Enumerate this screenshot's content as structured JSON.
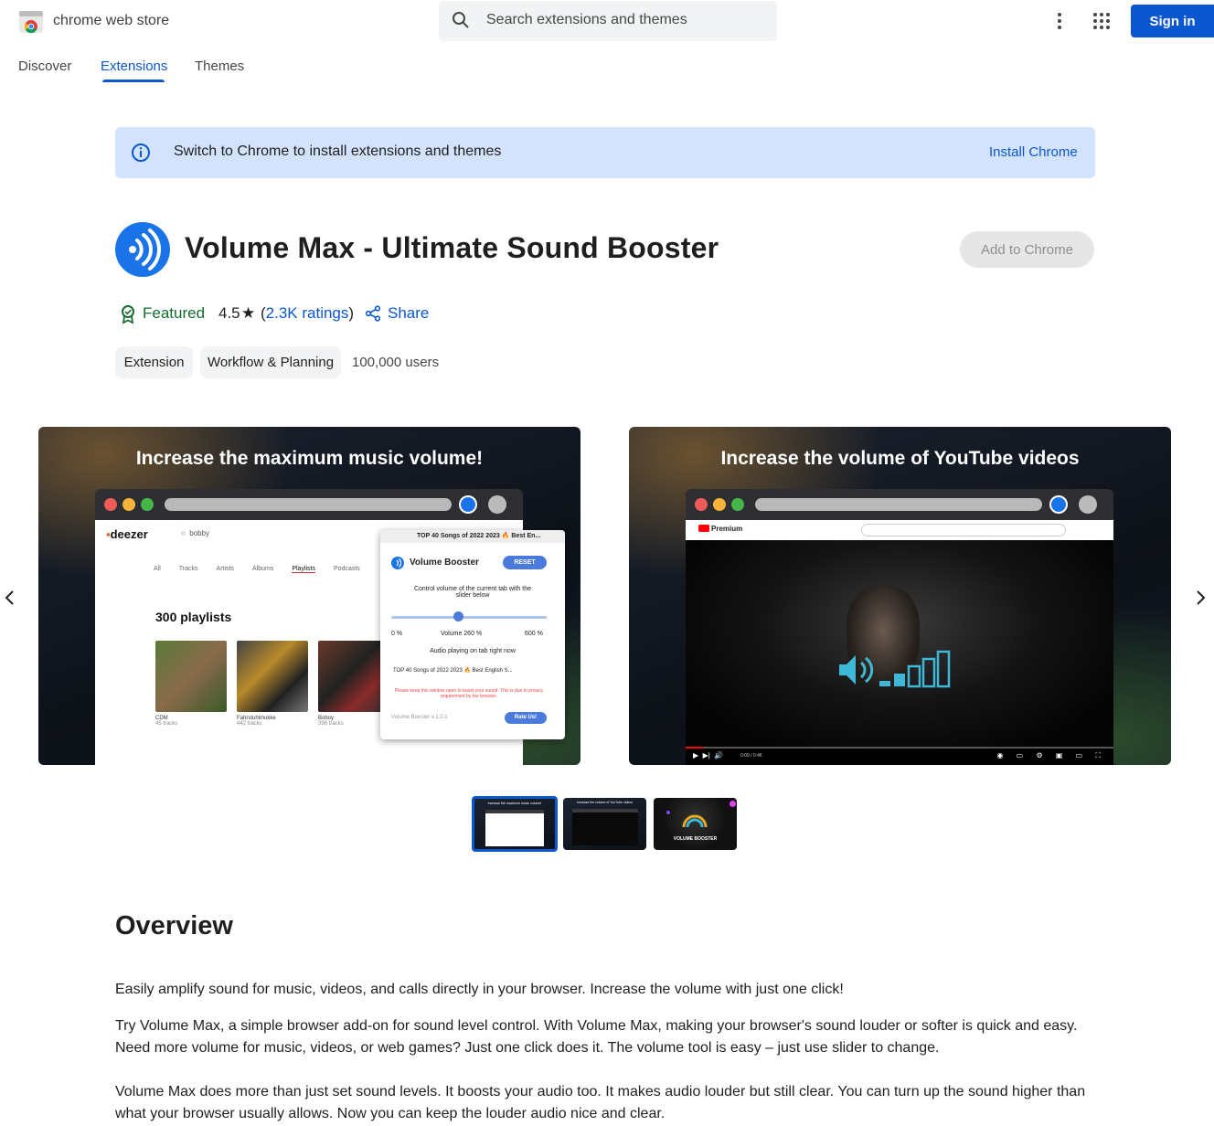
{
  "header": {
    "brand": "chrome web store",
    "search_placeholder": "Search extensions and themes",
    "sign_in": "Sign in"
  },
  "nav": {
    "discover": "Discover",
    "extensions": "Extensions",
    "themes": "Themes"
  },
  "banner": {
    "text": "Switch to Chrome to install extensions and themes",
    "link": "Install Chrome"
  },
  "extension": {
    "title": "Volume Max - Ultimate Sound Booster",
    "add_button": "Add to Chrome",
    "featured": "Featured",
    "rating": "4.5",
    "ratings_count": "2.3K ratings",
    "share": "Share",
    "chips": [
      "Extension",
      "Workflow & Planning"
    ],
    "users": "100,000 users"
  },
  "screenshots": {
    "shot1": {
      "title": "Increase the maximum music volume!",
      "deezer_brand": "deezer",
      "deezer_search": "bobby",
      "deezer_tabs": [
        "All",
        "Tracks",
        "Artists",
        "Albums",
        "Playlists",
        "Podcasts"
      ],
      "playlists_heading": "300 playlists",
      "thumbs": [
        {
          "name": "CDM",
          "sub": "45 tracks"
        },
        {
          "name": "Fahrstuhlmukke",
          "sub": "442 tracks"
        },
        {
          "name": "Boboy",
          "sub": "398 tracks"
        }
      ],
      "popup": {
        "tab_title": "TOP 40 Songs of 2022 2023 🔥 Best En...",
        "title": "Volume Booster",
        "reset": "RESET",
        "control_text": "Control volume of the current tab with the slider below",
        "min": "0 %",
        "volume": "Volume 260 %",
        "max": "600 %",
        "playing": "Audio playing on tab right now",
        "track": "TOP 40 Songs of 2022 2023 🔥 Best English S...",
        "warning": "Please keep this window open to boost your sound. This is due to privacy requirement by the browser.",
        "version": "Volume Booster v.1.0.1",
        "rate": "Rate Us!",
        "slider_fraction": 0.43
      }
    },
    "shot2": {
      "title": "Increase the volume of YouTube videos",
      "yt_logo": "Premium",
      "time": "0:09 / 0:46"
    },
    "thumb_captions": [
      "Increase the maximum music volume!",
      "Increase the volume of YouTube videos",
      "VOLUME BOOSTER"
    ]
  },
  "overview": {
    "title": "Overview",
    "p1": "Easily amplify sound for music, videos, and calls directly in your browser. Increase the volume with just one click!",
    "p2": "Try Volume Max, a simple browser add-on for sound level control. With Volume Max, making your browser's sound louder or softer is quick and easy. Need more volume for music, videos, or web games? Just one click does it. The volume tool is easy – just use slider to change.",
    "p3": "Volume Max does more than just set sound levels. It boosts your audio too. It makes audio louder but still clear. You can turn up the sound higher than what your browser usually allows. Now you can keep the louder audio nice and clear."
  },
  "colors": {
    "accent": "#0b57d0",
    "banner_bg": "#d3e3fd",
    "featured_green": "#146c2e",
    "icon_blue": "#1a73e8"
  }
}
